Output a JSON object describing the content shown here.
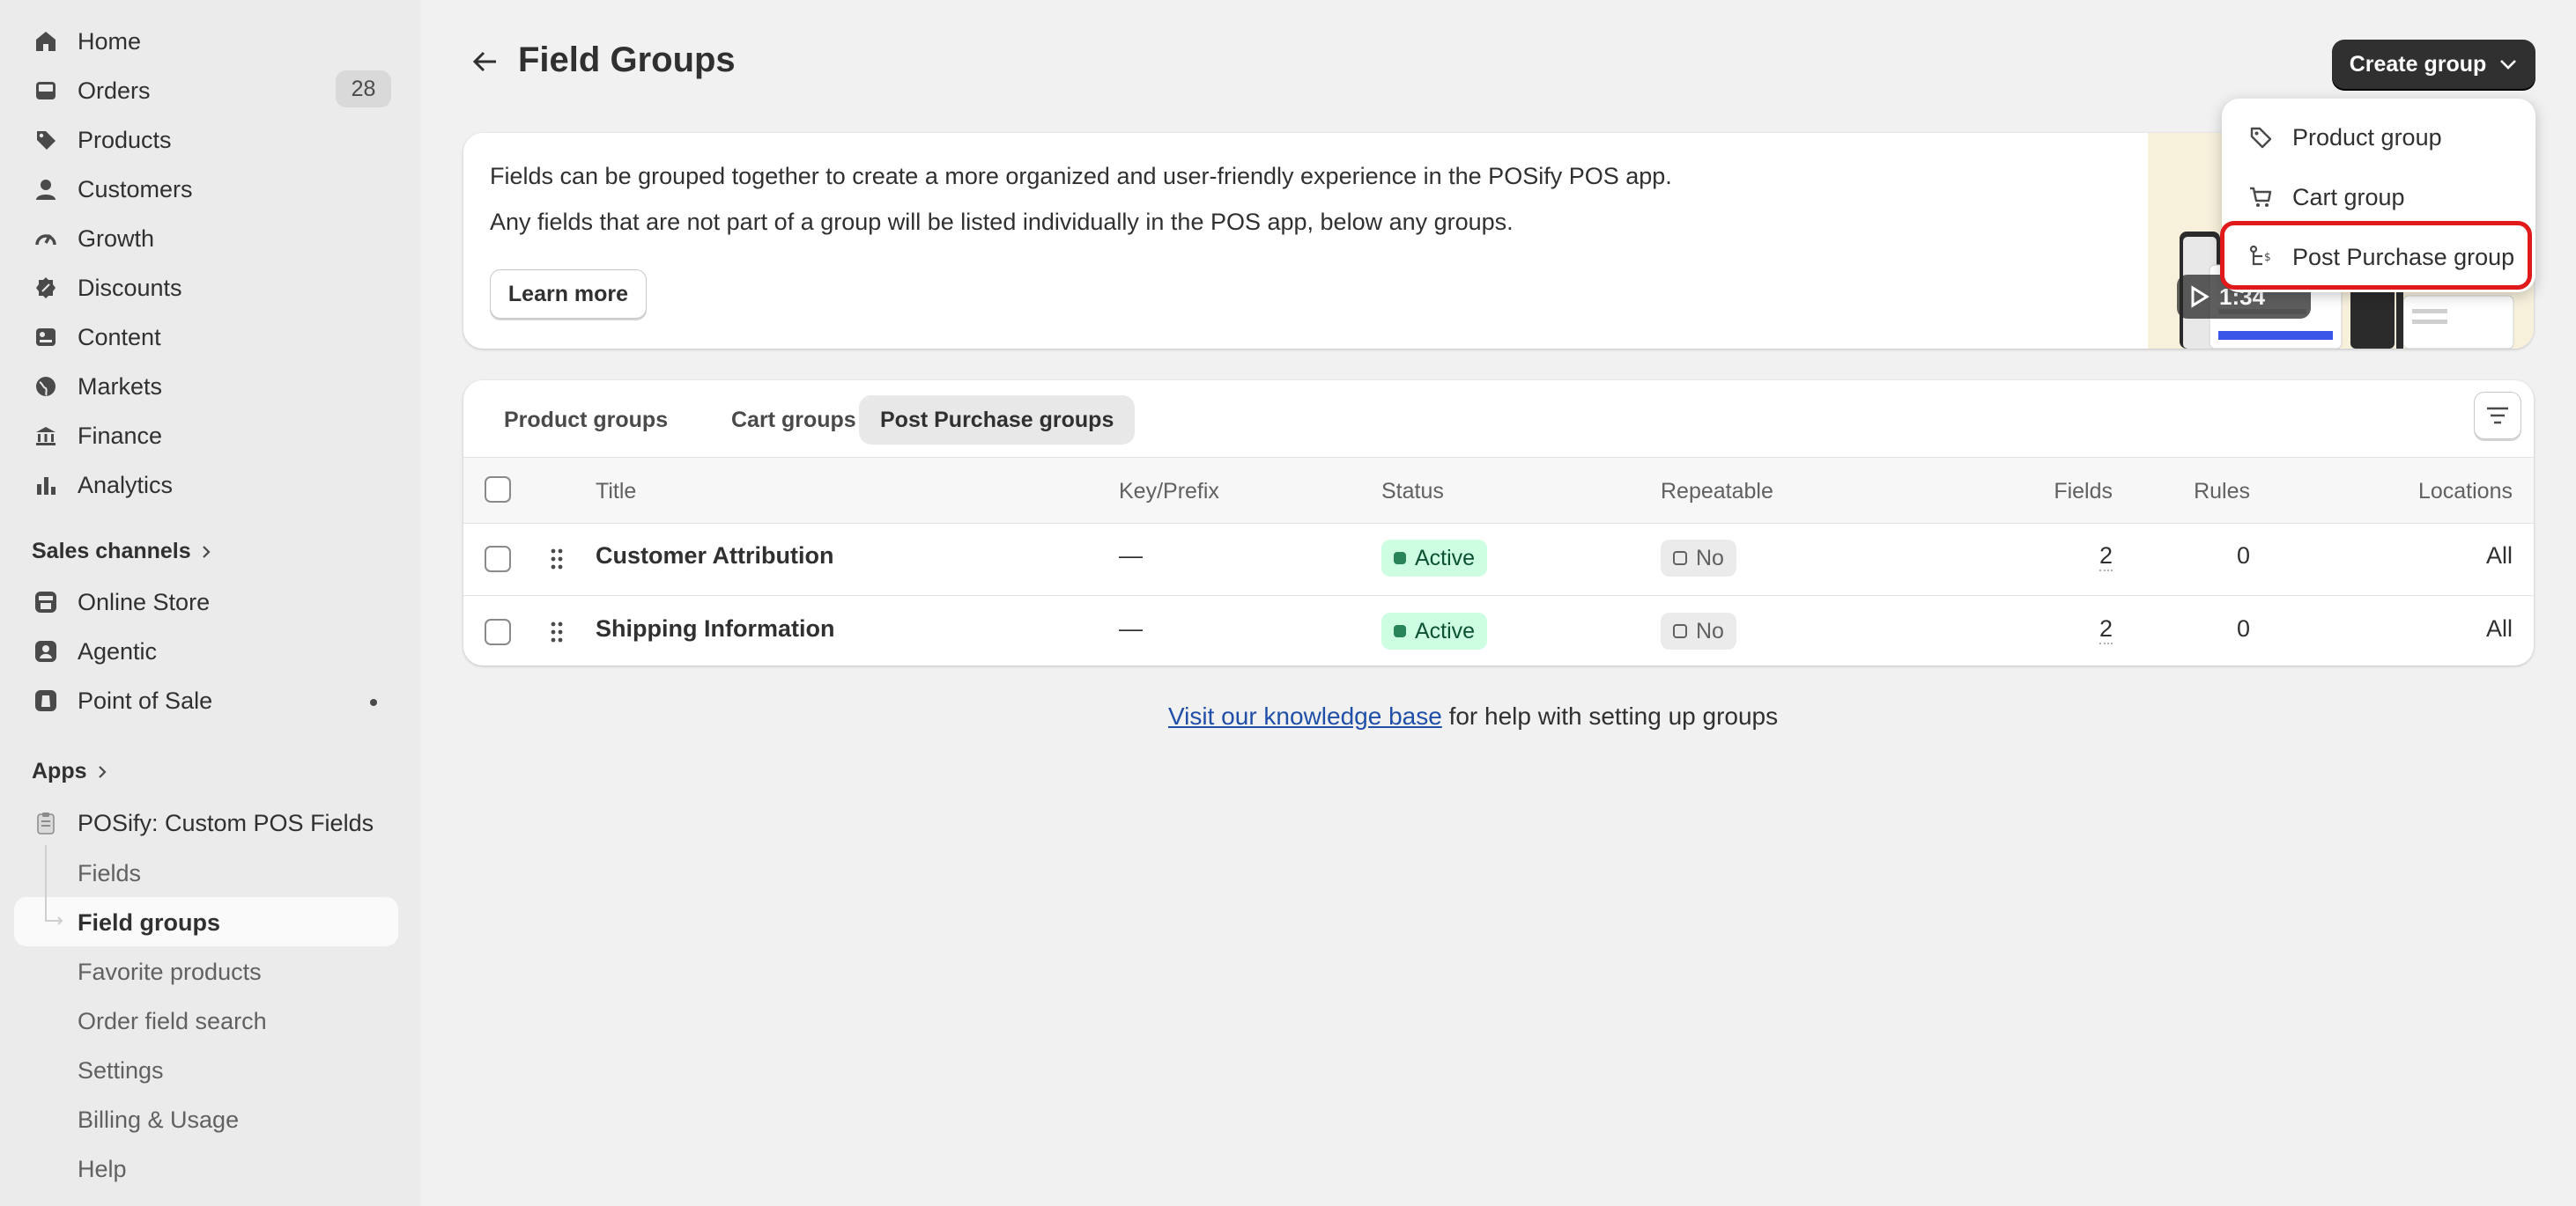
{
  "sidebar": {
    "nav": [
      {
        "label": "Home",
        "icon": "home-icon"
      },
      {
        "label": "Orders",
        "icon": "inbox-icon",
        "badge": "28"
      },
      {
        "label": "Products",
        "icon": "tag-icon"
      },
      {
        "label": "Customers",
        "icon": "person-icon"
      },
      {
        "label": "Growth",
        "icon": "gauge-icon"
      },
      {
        "label": "Discounts",
        "icon": "discount-icon"
      },
      {
        "label": "Content",
        "icon": "content-icon"
      },
      {
        "label": "Markets",
        "icon": "globe-icon"
      },
      {
        "label": "Finance",
        "icon": "bank-icon"
      },
      {
        "label": "Analytics",
        "icon": "bar-chart-icon"
      }
    ],
    "sales_channels_label": "Sales channels",
    "channels": [
      {
        "label": "Online Store",
        "icon": "store-icon"
      },
      {
        "label": "Agentic",
        "icon": "agentic-icon"
      },
      {
        "label": "Point of Sale",
        "icon": "pos-icon"
      }
    ],
    "apps_label": "Apps",
    "app_name": "POSify: Custom POS Fields",
    "app_items": [
      "Fields",
      "Field groups",
      "Favorite products",
      "Order field search",
      "Settings",
      "Billing & Usage",
      "Help"
    ],
    "active_item": "Field groups"
  },
  "header": {
    "title": "Field Groups",
    "create_label": "Create group"
  },
  "dropdown": {
    "items": [
      {
        "label": "Product group",
        "icon": "tag-icon"
      },
      {
        "label": "Cart group",
        "icon": "cart-icon"
      },
      {
        "label": "Post Purchase group",
        "icon": "flow-icon"
      }
    ],
    "highlighted": "Post Purchase group"
  },
  "info": {
    "line1": "Fields can be grouped together to create a more organized and user-friendly experience in the POSify POS app.",
    "line2": "Any fields that are not part of a group will be listed individually in the POS app, below any groups.",
    "learn_more": "Learn more",
    "video_duration": "1:34"
  },
  "tabs": [
    "Product groups",
    "Cart groups",
    "Post Purchase groups"
  ],
  "active_tab": "Post Purchase groups",
  "table": {
    "columns": [
      "Title",
      "Key/Prefix",
      "Status",
      "Repeatable",
      "Fields",
      "Rules",
      "Locations"
    ],
    "rows": [
      {
        "title": "Customer Attribution",
        "key": "—",
        "status": "Active",
        "repeatable": "No",
        "fields": "2",
        "rules": "0",
        "locations": "All"
      },
      {
        "title": "Shipping Information",
        "key": "—",
        "status": "Active",
        "repeatable": "No",
        "fields": "2",
        "rules": "0",
        "locations": "All"
      }
    ]
  },
  "footer": {
    "link_text": "Visit our knowledge base",
    "rest_text": " for help with setting up groups"
  }
}
